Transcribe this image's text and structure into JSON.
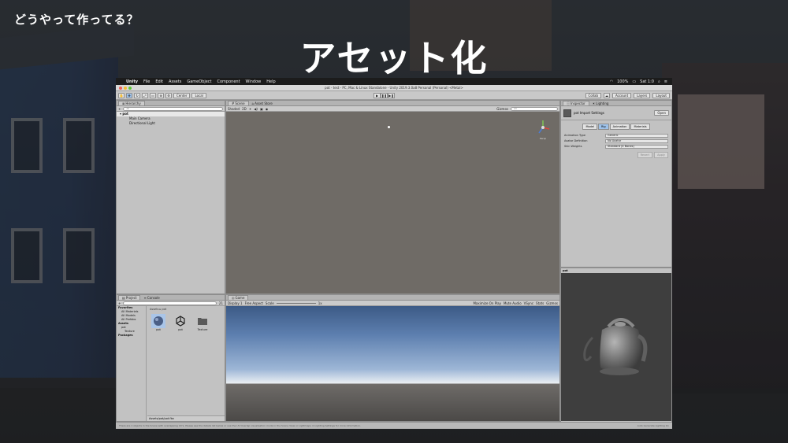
{
  "slide": {
    "subtitle": "どうやって作ってる？",
    "title": "アセット化"
  },
  "mac_menu": {
    "app": "Unity",
    "items": [
      "File",
      "Edit",
      "Assets",
      "GameObject",
      "Component",
      "Window",
      "Help"
    ],
    "battery": "100%",
    "clock": "Sat 1:0"
  },
  "window": {
    "title": "pot - test - PC, Mac & Linux Standalone - Unity 2019.3.0a8 Personal (Personal) <Metal>"
  },
  "toolbar": {
    "center_label": "Center",
    "local_label": "Local",
    "collab_label": "Collab",
    "account_label": "Account",
    "layers_label": "Layers",
    "layout_label": "Layout"
  },
  "hierarchy": {
    "tab": "Hierarchy",
    "create": "+",
    "search_placeholder": "All",
    "root": "pot",
    "children": [
      "Main Camera",
      "Directional Light"
    ]
  },
  "scene": {
    "tabs": [
      "Scene",
      "Asset Store"
    ],
    "shading": "Shaded",
    "mode_2d": "2D",
    "gizmos": "Gizmos",
    "search_placeholder": "All",
    "persp": "Persp"
  },
  "inspector": {
    "tabs": [
      "Inspector",
      "Lighting"
    ],
    "asset_title": "pot Import Settings",
    "open_label": "Open",
    "subtabs": [
      "Model",
      "Rig",
      "Animation",
      "Materials"
    ],
    "selected_subtab": "Rig",
    "props": [
      {
        "label": "Animation Type",
        "value": "Generic"
      },
      {
        "label": "Avatar Definition",
        "value": "No Avatar"
      },
      {
        "label": "Skin Weights",
        "value": "Standard (4 Bones)"
      }
    ],
    "revert_label": "Revert",
    "apply_label": "Apply"
  },
  "preview": {
    "header": "pot",
    "assetbundle_label": "AssetBundle",
    "bundle_value": "None",
    "variant_value": "None"
  },
  "project": {
    "tabs": [
      "Project",
      "Console"
    ],
    "create": "+",
    "count": "21",
    "tree": [
      {
        "label": "Favorites",
        "level": 0,
        "bold": true
      },
      {
        "label": "All Materials",
        "level": 1,
        "bold": false
      },
      {
        "label": "All Models",
        "level": 1,
        "bold": false
      },
      {
        "label": "All Prefabs",
        "level": 1,
        "bold": false
      },
      {
        "label": "Assets",
        "level": 0,
        "bold": true
      },
      {
        "label": "pot",
        "level": 1,
        "bold": false
      },
      {
        "label": "Texture",
        "level": 2,
        "bold": false
      },
      {
        "label": "Packages",
        "level": 0,
        "bold": true
      }
    ],
    "breadcrumb": "Assets ▸ pot",
    "assets": [
      {
        "label": "pot",
        "icon": "model-icon"
      },
      {
        "label": "pot",
        "icon": "unity-scene-icon"
      },
      {
        "label": "Texture",
        "icon": "folder-icon"
      }
    ],
    "footer": "Assets/pot/pot.fbx"
  },
  "game": {
    "tab": "Game",
    "display": "Display 1",
    "aspect": "Free Aspect",
    "scale_label": "Scale",
    "scale_value": "1x",
    "toggles": [
      "Maximize On Play",
      "Mute Audio",
      "VSync",
      "Stats",
      "Gizmos"
    ]
  },
  "status": {
    "message": "There are 1 objects in the Scene with overlapping UV's. Please see the details list below or use the UV Overlap visualisation mode in the Scene View or Lightmaps in Lighting Settings for more information.",
    "right": "Auto Generate Lighting On"
  },
  "colors": {
    "scene_bg": "#6f6b66",
    "selection": "#9ec2ea",
    "panel": "#c2c2c2"
  }
}
